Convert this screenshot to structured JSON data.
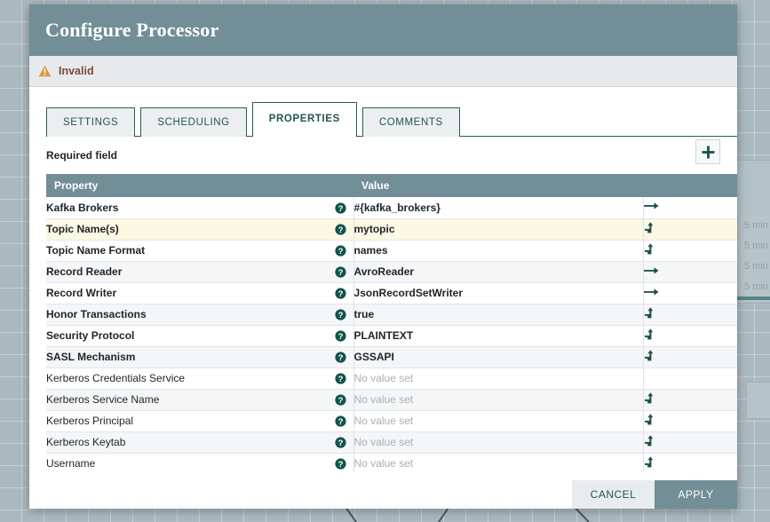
{
  "dialog": {
    "title": "Configure Processor",
    "status": {
      "text": "Invalid",
      "icon": "warning-triangle-icon",
      "color": "#d99a3c"
    },
    "tabs": [
      {
        "label": "SETTINGS",
        "active": false
      },
      {
        "label": "SCHEDULING",
        "active": false
      },
      {
        "label": "PROPERTIES",
        "active": true
      },
      {
        "label": "COMMENTS",
        "active": false
      }
    ],
    "required_field_label": "Required field",
    "add_button": {
      "icon": "plus-icon",
      "label": "+"
    },
    "footer": {
      "cancel_label": "CANCEL",
      "apply_label": "APPLY"
    }
  },
  "table": {
    "columns": [
      "Property",
      "Value"
    ],
    "no_value_placeholder": "No value set",
    "rows": [
      {
        "property": "Kafka Brokers",
        "value": "#{kafka_brokers}",
        "required": true,
        "has_value": true,
        "action_icon": "arrow-right-icon",
        "selected": false
      },
      {
        "property": "Topic Name(s)",
        "value": "mytopic",
        "required": true,
        "has_value": true,
        "action_icon": "expression-arrow-icon",
        "selected": true
      },
      {
        "property": "Topic Name Format",
        "value": "names",
        "required": true,
        "has_value": true,
        "action_icon": "expression-arrow-icon",
        "selected": false
      },
      {
        "property": "Record Reader",
        "value": "AvroReader",
        "required": true,
        "has_value": true,
        "action_icon": "arrow-right-icon",
        "selected": false
      },
      {
        "property": "Record Writer",
        "value": "JsonRecordSetWriter",
        "required": true,
        "has_value": true,
        "action_icon": "arrow-right-icon",
        "selected": false
      },
      {
        "property": "Honor Transactions",
        "value": "true",
        "required": true,
        "has_value": true,
        "action_icon": "expression-arrow-icon",
        "selected": false
      },
      {
        "property": "Security Protocol",
        "value": "PLAINTEXT",
        "required": true,
        "has_value": true,
        "action_icon": "expression-arrow-icon",
        "selected": false
      },
      {
        "property": "SASL Mechanism",
        "value": "GSSAPI",
        "required": true,
        "has_value": true,
        "action_icon": "expression-arrow-icon",
        "selected": false
      },
      {
        "property": "Kerberos Credentials Service",
        "value": "No value set",
        "required": false,
        "has_value": false,
        "action_icon": "",
        "selected": false
      },
      {
        "property": "Kerberos Service Name",
        "value": "No value set",
        "required": false,
        "has_value": false,
        "action_icon": "expression-arrow-icon",
        "selected": false
      },
      {
        "property": "Kerberos Principal",
        "value": "No value set",
        "required": false,
        "has_value": false,
        "action_icon": "expression-arrow-icon",
        "selected": false
      },
      {
        "property": "Kerberos Keytab",
        "value": "No value set",
        "required": false,
        "has_value": false,
        "action_icon": "expression-arrow-icon",
        "selected": false
      },
      {
        "property": "Username",
        "value": "No value set",
        "required": false,
        "has_value": false,
        "action_icon": "expression-arrow-icon",
        "selected": false
      }
    ],
    "help_icon": "question-mark-icon"
  },
  "background_canvas": {
    "processor_schedule_labels": [
      "5 min",
      "5 min",
      "5 min",
      "5 min"
    ]
  },
  "colors": {
    "titlebar": "#728e97",
    "accent": "#2a5d57",
    "selected_row": "#fdf8e4",
    "warning": "#d99a3c",
    "canvas": "#aab9c0"
  }
}
